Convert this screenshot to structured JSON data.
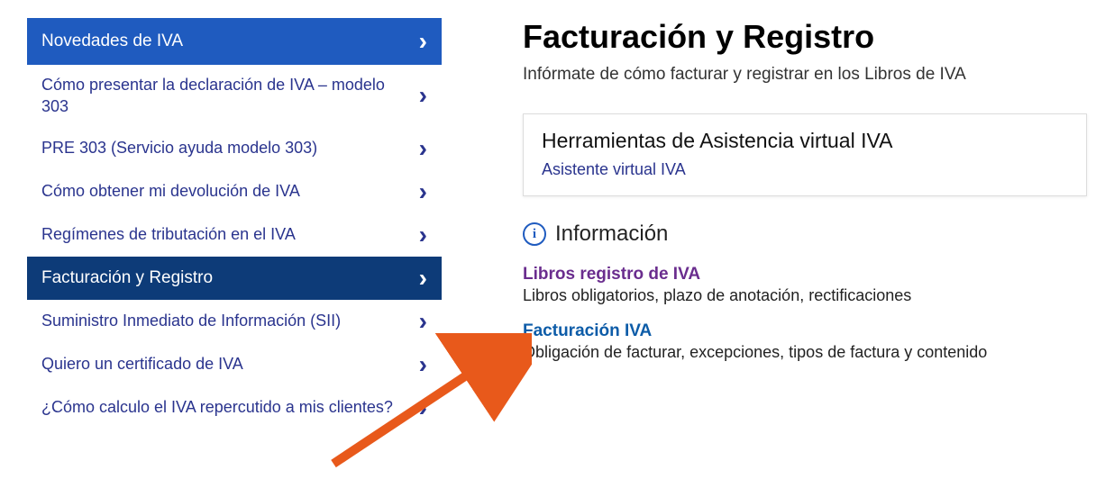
{
  "sidebar": {
    "items": [
      {
        "label": "Novedades de IVA",
        "style": "level0"
      },
      {
        "label": "Cómo presentar la declaración de IVA – modelo 303",
        "style": "link"
      },
      {
        "label": "PRE 303 (Servicio ayuda modelo 303)",
        "style": "link"
      },
      {
        "label": "Cómo obtener mi devolución de IVA",
        "style": "link"
      },
      {
        "label": "Regímenes de tributación en el IVA",
        "style": "link"
      },
      {
        "label": "Facturación y Registro",
        "style": "level1"
      },
      {
        "label": "Suministro Inmediato de Información (SII)",
        "style": "link"
      },
      {
        "label": "Quiero un certificado de IVA",
        "style": "link"
      },
      {
        "label": "¿Cómo calculo el IVA repercutido a mis clientes?",
        "style": "link"
      }
    ]
  },
  "main": {
    "title": "Facturación y Registro",
    "subtitle": "Infórmate de cómo facturar y registrar en los Libros de IVA",
    "tool_card": {
      "title": "Herramientas de Asistencia virtual IVA",
      "link": "Asistente virtual IVA"
    },
    "info_header": "Información",
    "info_items": [
      {
        "title": "Libros registro de IVA",
        "desc": "Libros obligatorios, plazo de anotación, rectificaciones",
        "visited": true
      },
      {
        "title": "Facturación IVA",
        "desc": "Obligación de facturar, excepciones, tipos de factura y contenido",
        "visited": false
      }
    ]
  }
}
